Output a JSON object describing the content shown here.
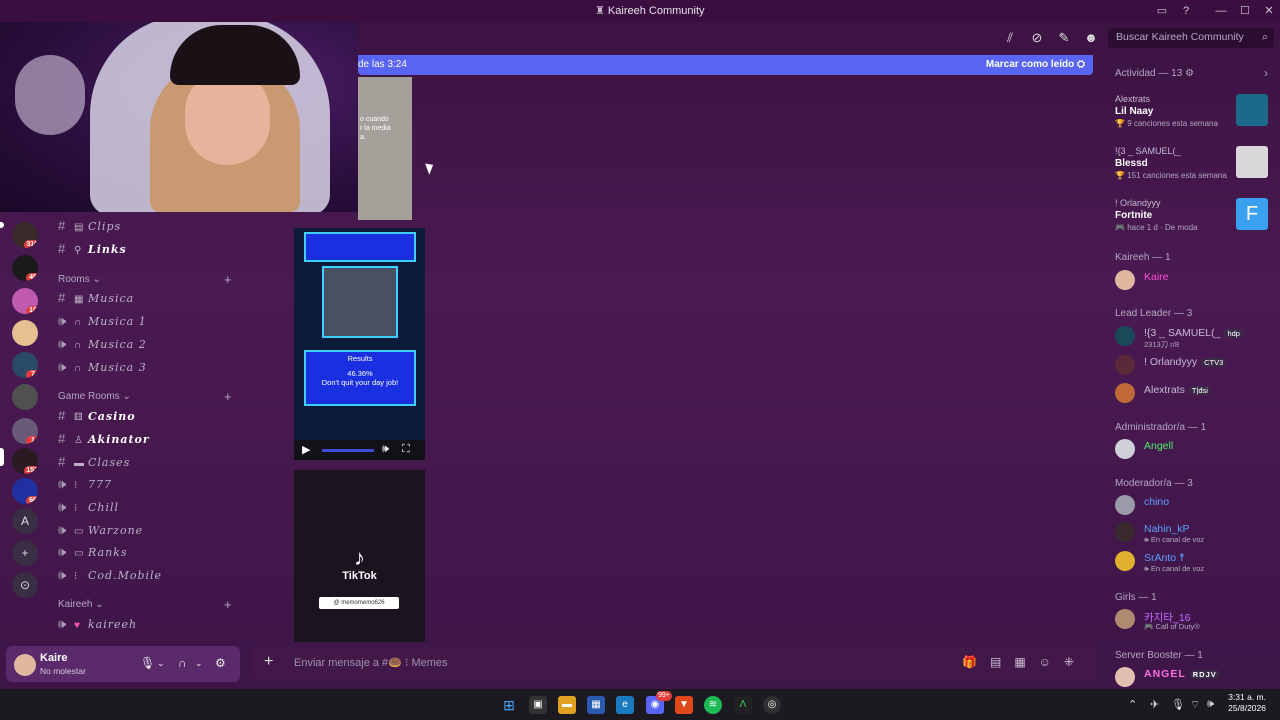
{
  "window": {
    "title": "Kaireeh Community"
  },
  "toolbar": {
    "search_placeholder": "Buscar Kaireeh Community"
  },
  "banner": {
    "left_text": "de las 3:24",
    "right_text": "Marcar como leído"
  },
  "servers": [
    {
      "badge": "316"
    },
    {
      "badge": "49"
    },
    {
      "badge": "10"
    },
    {
      "badge": ""
    },
    {
      "badge": "7"
    },
    {
      "badge": ""
    },
    {
      "badge": "1"
    },
    {
      "badge": "152"
    },
    {
      "badge": "66"
    }
  ],
  "server_letter": "A",
  "channels": {
    "top": [
      {
        "name": "Clips",
        "icon": "film"
      },
      {
        "name": "Links",
        "icon": "link"
      }
    ],
    "rooms_label": "Rooms",
    "rooms": [
      {
        "name": "Musica",
        "icon": "keyboard"
      },
      {
        "name": "Musica 1",
        "icon": "headphones"
      },
      {
        "name": "Musica 2",
        "icon": "headphones"
      },
      {
        "name": "Musica 3",
        "icon": "headphones"
      }
    ],
    "game_rooms_label": "Game Rooms",
    "game_rooms": [
      {
        "name": "Casino",
        "icon": "dice"
      },
      {
        "name": "Akinator",
        "icon": "genie"
      },
      {
        "name": "Clases",
        "icon": "flag"
      },
      {
        "name": "777",
        "icon": "slot"
      },
      {
        "name": "Chill",
        "icon": "ghost"
      },
      {
        "name": "Warzone",
        "icon": "gamepad"
      },
      {
        "name": "Ranks",
        "icon": "gamepad"
      },
      {
        "name": "Cod.Mobile",
        "icon": "phone"
      }
    ],
    "kaireeh_label": "Kaireeh",
    "kaireeh": [
      {
        "name": "kaireeh",
        "icon": "heart"
      }
    ]
  },
  "user": {
    "name": "Kaire",
    "status": "No molestar"
  },
  "feed": {
    "media1_caption": "o cuando\nr la media\na.",
    "results_title": "Results",
    "results_pct": "46.36%",
    "results_msg": "Don't quit your day job!",
    "tiktok_word": "TikTok",
    "tiktok_handle": "@ memomemo626"
  },
  "composer": {
    "placeholder": "Enviar mensaje a #🍩 ⁝ Memes"
  },
  "members": {
    "activity_label": "Actividad — 13",
    "activities": [
      {
        "who": "Alextrats",
        "game": "Lil Naay",
        "meta": "9 canciones esta semana"
      },
      {
        "who": "!{3 _ SAMUEL(_",
        "game": "Blessd",
        "meta": "151 canciones esta semana"
      },
      {
        "who": "! Orlandyyy",
        "game": "Fortnite",
        "meta": "hace 1 d",
        "meta2": "De moda"
      }
    ],
    "sections": [
      {
        "label": "Kaireeh — 1"
      },
      {
        "label": "Lead Leader — 3"
      },
      {
        "label": "Administrador/a — 1"
      },
      {
        "label": "Moderador/a — 3"
      },
      {
        "label": "Girls — 1"
      },
      {
        "label": "Server Booster — 1"
      }
    ],
    "list": [
      {
        "name": "Kaire",
        "color": "#ff4fd8"
      },
      {
        "name": "!{3 _ SAMUEL(_",
        "sub": "2313刀 r/8",
        "tag": "hdp",
        "color": "#c9b9d5"
      },
      {
        "name": "! Orlandyyy",
        "tag": "CTV3",
        "color": "#c9b9d5"
      },
      {
        "name": "Alextrats",
        "tag": "T|đsi",
        "color": "#c9b9d5"
      },
      {
        "name": "Angell",
        "color": "#4cf06a"
      },
      {
        "name": "chino",
        "color": "#5aa0ff"
      },
      {
        "name": "Nahin_kP",
        "sub": "En canal de voz",
        "color": "#5aa0ff"
      },
      {
        "name": "SrAnto ☨",
        "sub": "En canal de voz",
        "color": "#5aa0ff"
      },
      {
        "name": "카지타_16",
        "sub": "Call of Duty®",
        "color": "#c46cff"
      },
      {
        "name": "ANGEL",
        "tag": "RDJV",
        "color": "#ff6fe0"
      }
    ]
  },
  "clock": {
    "time": "3:31 a. m.",
    "date": "25/8/2026"
  },
  "taskbar_badge": "99+"
}
